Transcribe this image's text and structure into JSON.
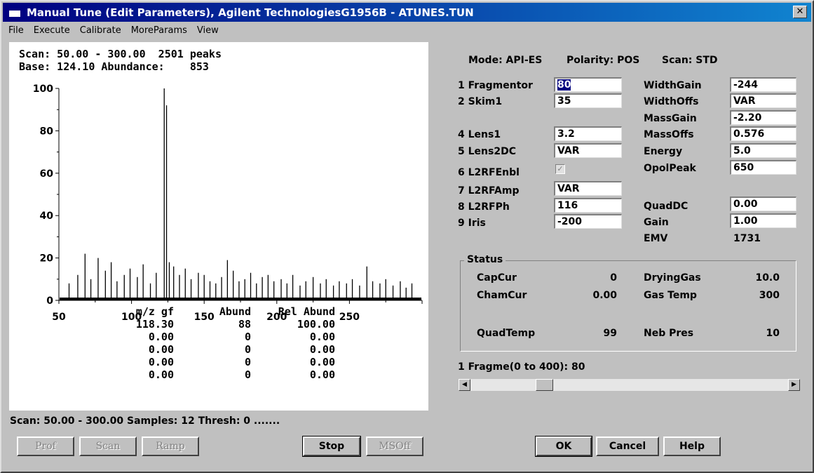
{
  "window": {
    "title": "Manual Tune (Edit Parameters), Agilent TechnologiesG1956B - ATUNES.TUN",
    "close_label": "✕"
  },
  "menu": [
    "File",
    "Execute",
    "Calibrate",
    "MoreParams",
    "View"
  ],
  "plot": {
    "header_line1": "Scan: 50.00 - 300.00  2501 peaks",
    "header_line2": "Base: 124.10 Abundance:    853",
    "y_ticks": [
      "100",
      "80",
      "60",
      "40",
      "20",
      "0"
    ],
    "x_ticks": [
      "50",
      "100",
      "150",
      "200",
      "250"
    ]
  },
  "chart_data": {
    "type": "bar",
    "xlim": [
      50,
      300
    ],
    "ylim": [
      0,
      100
    ],
    "x_ticks": [
      50,
      100,
      150,
      200,
      250
    ],
    "y_ticks": [
      0,
      20,
      40,
      60,
      80,
      100
    ],
    "series": [
      {
        "x": [
          57,
          63,
          68,
          72,
          77,
          82,
          86,
          90,
          95,
          99,
          104,
          108,
          113,
          117,
          122.5,
          124.1,
          126,
          129,
          133,
          137,
          141,
          146,
          150,
          154,
          158,
          162,
          166,
          170,
          174,
          178,
          182,
          186,
          190,
          194,
          198,
          203,
          207,
          211,
          216,
          220,
          225,
          230,
          234,
          239,
          243,
          248,
          252,
          257,
          262,
          266,
          271,
          275,
          280,
          285,
          289,
          293
        ],
        "values": [
          8,
          12,
          22,
          10,
          20,
          14,
          18,
          9,
          12,
          15,
          11,
          17,
          8,
          13,
          100,
          92,
          18,
          16,
          12,
          15,
          10,
          13,
          12,
          9,
          8,
          11,
          19,
          14,
          9,
          10,
          13,
          8,
          11,
          12,
          9,
          10,
          8,
          12,
          7,
          9,
          11,
          8,
          10,
          7,
          9,
          8,
          10,
          7,
          16,
          9,
          8,
          10,
          7,
          9,
          6,
          8
        ]
      }
    ]
  },
  "peak_table": {
    "headers": [
      "m/z gf",
      "Abund",
      "Rel Abund"
    ],
    "rows": [
      [
        "118.30",
        "88",
        "100.00"
      ],
      [
        "0.00",
        "0",
        "0.00"
      ],
      [
        "0.00",
        "0",
        "0.00"
      ],
      [
        "0.00",
        "0",
        "0.00"
      ],
      [
        "0.00",
        "0",
        "0.00"
      ]
    ]
  },
  "scan_status": "Scan: 50.00 - 300.00 Samples: 12 Thresh: 0 .......",
  "buttons": {
    "prof": "Prof",
    "scan": "Scan",
    "ramp": "Ramp",
    "stop": "Stop",
    "msoff": "MSOff",
    "ok": "OK",
    "cancel": "Cancel",
    "help": "Help"
  },
  "mode_line": {
    "mode": "Mode: API-ES",
    "polarity": "Polarity: POS",
    "scan": "Scan: STD"
  },
  "params_left": [
    {
      "label": "1 Fragmentor",
      "value": "80"
    },
    {
      "label": "2 Skim1",
      "value": "35"
    },
    {
      "label": "4 Lens1",
      "value": "3.2"
    },
    {
      "label": "5 Lens2DC",
      "value": "VAR"
    },
    {
      "label": "6 L2RFEnbl",
      "value": ""
    },
    {
      "label": "7 L2RFAmp",
      "value": "VAR"
    },
    {
      "label": "8 L2RFPh",
      "value": "116"
    },
    {
      "label": "9 Iris",
      "value": "-200"
    }
  ],
  "params_right": [
    {
      "label": "WidthGain",
      "value": "-244"
    },
    {
      "label": "WidthOffs",
      "value": "VAR"
    },
    {
      "label": "MassGain",
      "value": "-2.20"
    },
    {
      "label": "MassOffs",
      "value": "0.576"
    },
    {
      "label": "Energy",
      "value": "5.0"
    },
    {
      "label": "OpolPeak",
      "value": "650"
    },
    {
      "label": "QuadDC",
      "value": "0.00"
    },
    {
      "label": "Gain",
      "value": "1.00"
    },
    {
      "label": "EMV",
      "value": "1731"
    }
  ],
  "status": {
    "title": "Status",
    "items": [
      {
        "label": "CapCur",
        "value": "0"
      },
      {
        "label": "DryingGas",
        "value": "10.0"
      },
      {
        "label": "ChamCur",
        "value": "0.00"
      },
      {
        "label": "Gas Temp",
        "value": "300"
      },
      {
        "label": "QuadTemp",
        "value": "99"
      },
      {
        "label": "Neb Pres",
        "value": "10"
      }
    ]
  },
  "slider": {
    "label": "1 Fragme(0 to  400): 80"
  }
}
